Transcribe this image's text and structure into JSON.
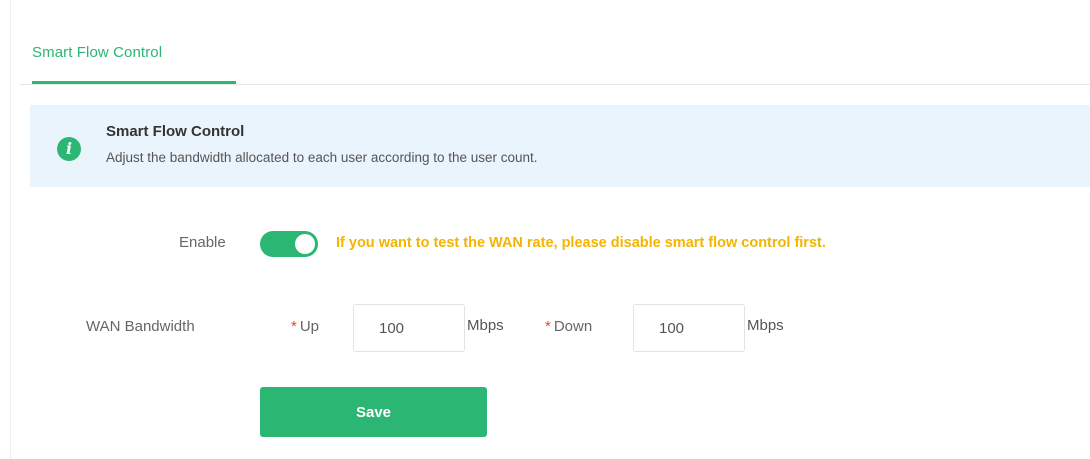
{
  "tabs": [
    {
      "label": "Smart Flow Control",
      "active": true
    }
  ],
  "info": {
    "icon": "info-icon",
    "title": "Smart Flow Control",
    "description": "Adjust the bandwidth allocated to each user according to the user count."
  },
  "form": {
    "enable_label": "Enable",
    "enable_on": true,
    "warning": "If you want to test the WAN rate, please disable smart flow control first.",
    "wan_label": "WAN Bandwidth",
    "required_mark": "*",
    "up_label": "Up",
    "up_value": "100",
    "up_unit": "Mbps",
    "down_label": "Down",
    "down_value": "100",
    "down_unit": "Mbps",
    "save_label": "Save"
  },
  "colors": {
    "accent": "#2bb673",
    "warning": "#f4b400",
    "info_background": "#eaf4fd",
    "required": "#f04134"
  }
}
